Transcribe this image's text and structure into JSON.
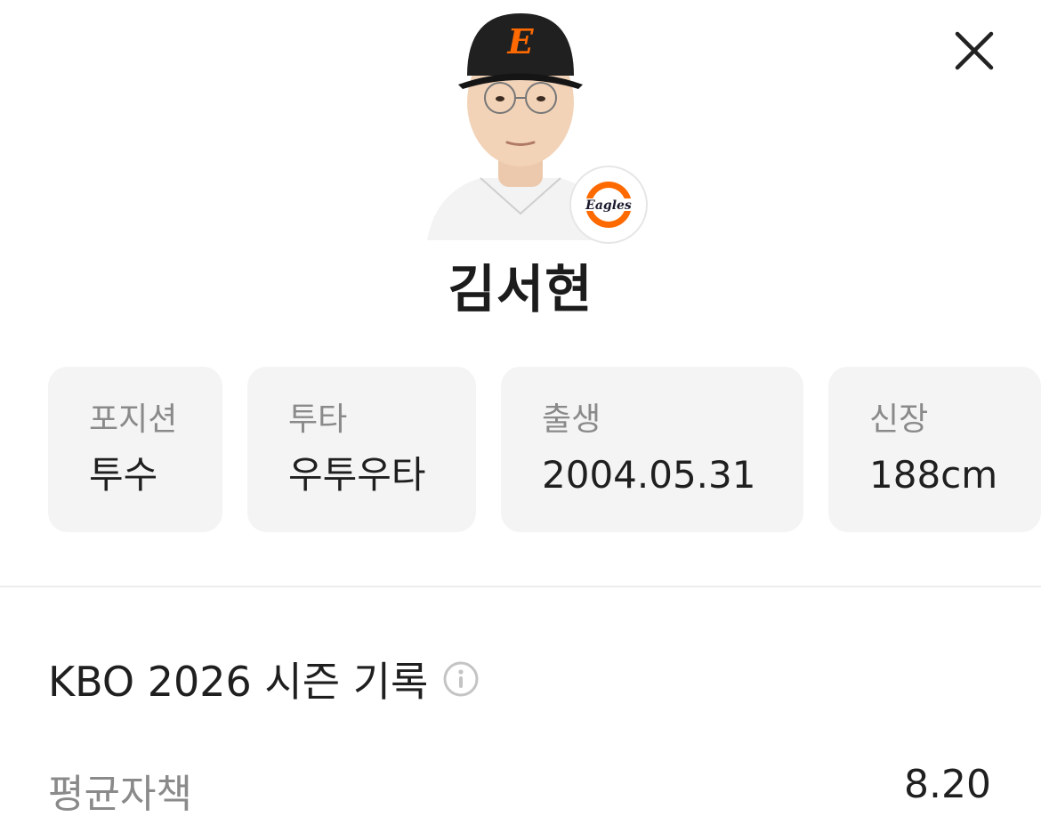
{
  "player": {
    "name": "김서현",
    "team_badge_text": "Eagles",
    "cap_letter": "E"
  },
  "info_cards": [
    {
      "label": "포지션",
      "value": "투수"
    },
    {
      "label": "투타",
      "value": "우투우타"
    },
    {
      "label": "출생",
      "value": "2004.05.31"
    },
    {
      "label": "신장",
      "value": "188cm"
    }
  ],
  "season": {
    "title": "KBO 2026 시즌 기록",
    "stats": [
      {
        "label": "평균자책",
        "value": "8.20"
      }
    ]
  },
  "colors": {
    "accent": "#ff6a00",
    "card_bg": "#f4f4f4",
    "label": "#8a8a8a",
    "text": "#1f1f1f"
  },
  "icons": {
    "close": "close-icon",
    "info": "info-icon"
  }
}
